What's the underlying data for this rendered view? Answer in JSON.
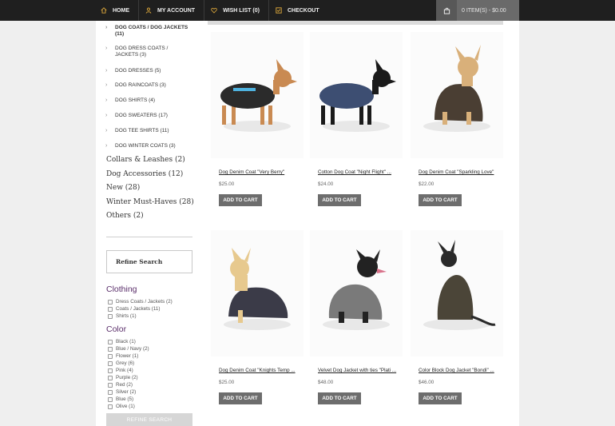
{
  "topnav": {
    "items": [
      {
        "label": "HOME",
        "icon": "home-icon"
      },
      {
        "label": "MY ACCOUNT",
        "icon": "user-icon"
      },
      {
        "label": "WISH LIST (0)",
        "icon": "heart-icon"
      },
      {
        "label": "CHECKOUT",
        "icon": "checkout-icon"
      }
    ],
    "cart_label": "0 ITEM(S) - $0.00",
    "accent": "#d8a43a"
  },
  "sidebar": {
    "subcategories": [
      {
        "label": "DOG COATS / DOG JACKETS (11)"
      },
      {
        "label": "DOG DRESS COATS / JACKETS (3)"
      },
      {
        "label": "DOG DRESSES (5)"
      },
      {
        "label": "DOG RAINCOATS (3)"
      },
      {
        "label": "DOG SHIRTS (4)"
      },
      {
        "label": "DOG SWEATERS (17)"
      },
      {
        "label": "DOG TEE SHIRTS (11)"
      },
      {
        "label": "DOG WINTER COATS (3)"
      }
    ],
    "categories": [
      {
        "label": "Collars & Leashes (2)"
      },
      {
        "label": "Dog Accessories (12)"
      },
      {
        "label": "New (28)"
      },
      {
        "label": "Winter Must-Haves (28)"
      },
      {
        "label": "Others (2)"
      }
    ],
    "refine_title": "Refine Search",
    "clothing_title": "Clothing",
    "clothing_options": [
      {
        "label": "Dress Coats / Jackets (2)"
      },
      {
        "label": "Coats / Jackets (11)"
      },
      {
        "label": "Shirts (1)"
      }
    ],
    "color_title": "Color",
    "color_options": [
      {
        "label": "Black (1)"
      },
      {
        "label": "Blue / Navy (2)"
      },
      {
        "label": "Flower (1)"
      },
      {
        "label": "Grey (6)"
      },
      {
        "label": "Pink (4)"
      },
      {
        "label": "Purple (2)"
      },
      {
        "label": "Red (2)"
      },
      {
        "label": "Silver (2)"
      },
      {
        "label": "Blue (5)"
      },
      {
        "label": "Olive (1)"
      }
    ],
    "refine_button": "REFINE SEARCH"
  },
  "products": [
    {
      "name": "Dog Denim Coat \"Very Berry\"",
      "price": "$25.00",
      "button": "ADD TO CART",
      "coat_color": "#2b2b2b",
      "dog_color": "#c98a52"
    },
    {
      "name": "Cotton Dog Coat \"Night Flight\" ...",
      "price": "$24.00",
      "button": "ADD TO CART",
      "coat_color": "#3d4e72",
      "dog_color": "#1a1a1a"
    },
    {
      "name": "Dog Denim Coat \"Sparkling Love\"",
      "price": "$22.00",
      "button": "ADD TO CART",
      "coat_color": "#4a3e33",
      "dog_color": "#d9b07a"
    },
    {
      "name": "Dog Denim Coat \"Knights Temp ...",
      "price": "$25.00",
      "button": "ADD TO CART",
      "coat_color": "#3b3b48",
      "dog_color": "#e7c98e"
    },
    {
      "name": "Velvet Dog Jacket with ties \"Plati ...",
      "price": "$48.00",
      "button": "ADD TO CART",
      "coat_color": "#7a7a7a",
      "dog_color": "#222222"
    },
    {
      "name": "Color Block Dog Jacket \"Bondi\" ...",
      "price": "$46.00",
      "button": "ADD TO CART",
      "coat_color": "#4b4538",
      "dog_color": "#2a2a2a"
    }
  ]
}
